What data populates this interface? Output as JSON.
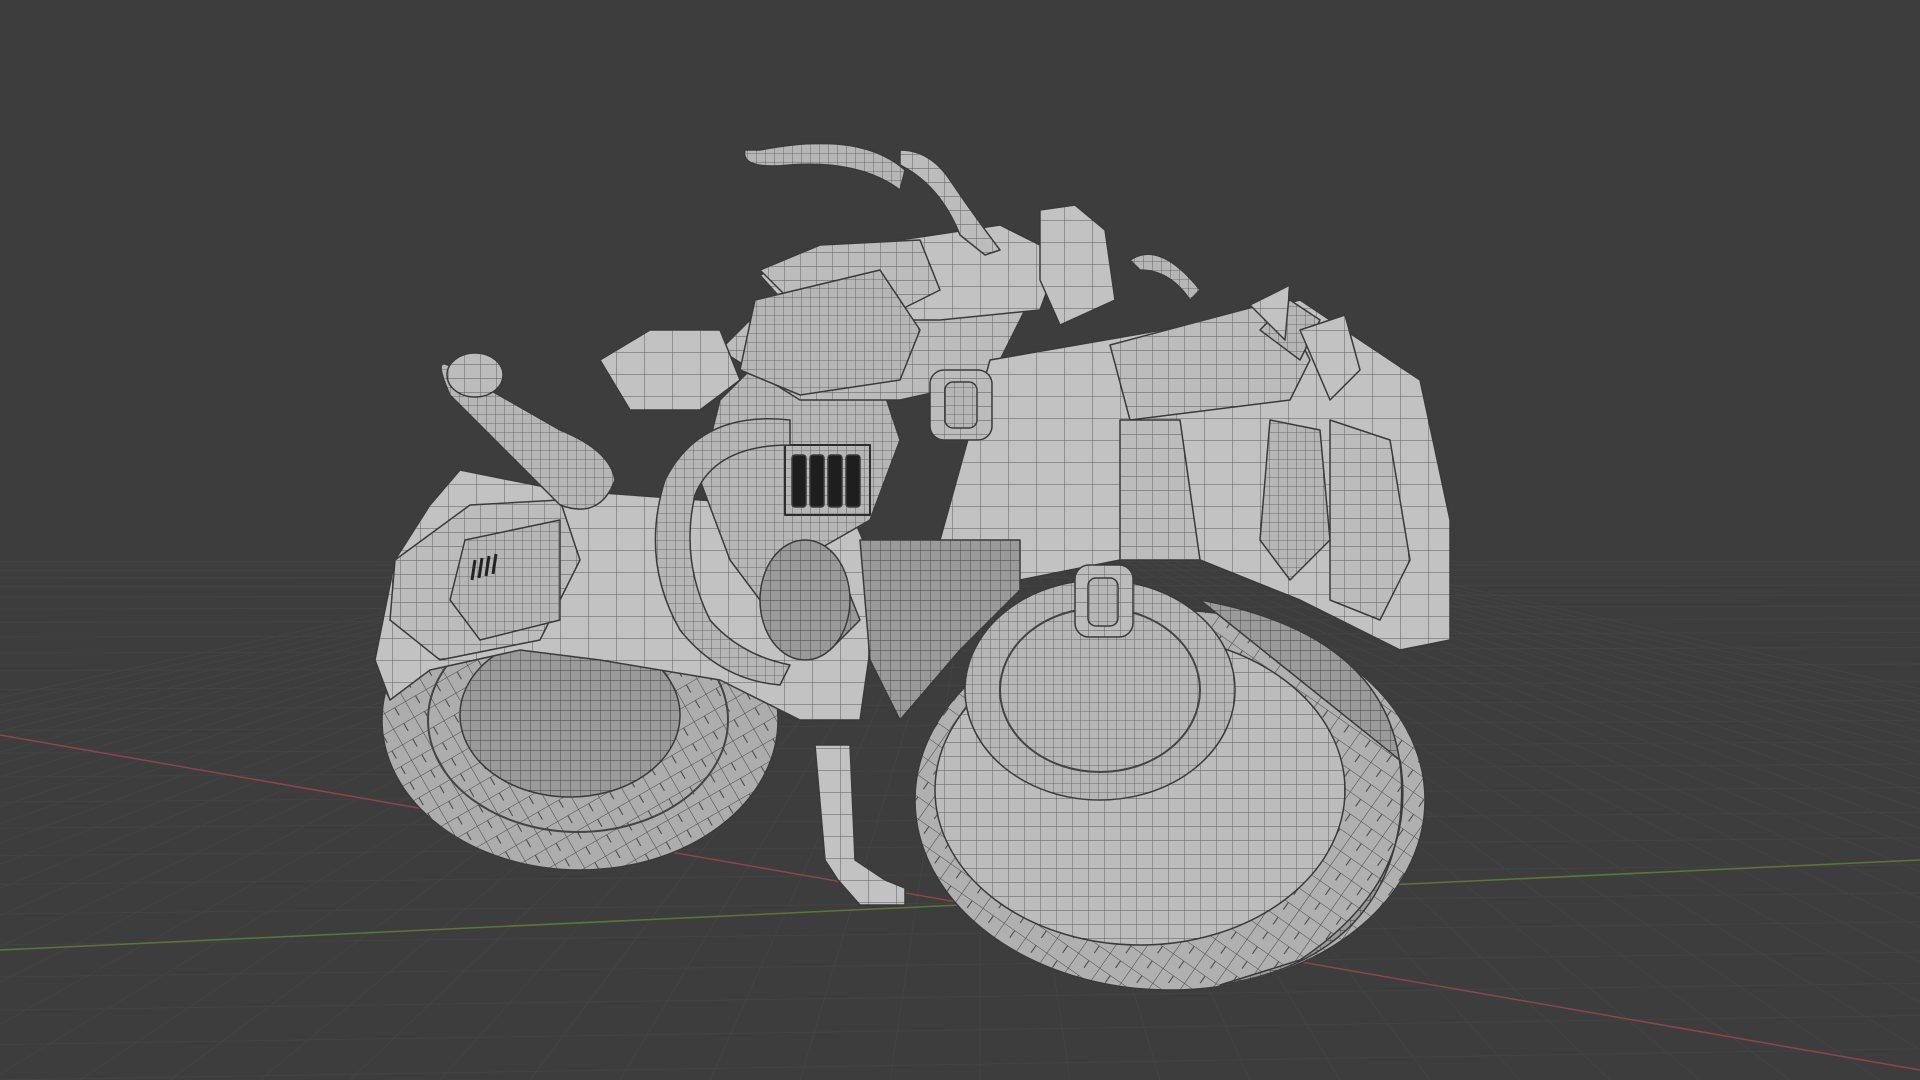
{
  "viewport": {
    "background_color": "#3d3d3d",
    "grid_color": "#4a4a4a",
    "grid_line_color": "#444444",
    "x_axis_color": "#9a4a4a",
    "y_axis_color": "#5d8a3a"
  },
  "model": {
    "subject": "motorcycle",
    "display_mode": "solid-with-wireframe",
    "surface_color": "#b4b4b4",
    "surface_light_color": "#cfcfcf",
    "surface_dark_color": "#8a8a8a",
    "wire_color": "#4a4a4a",
    "parts": [
      {
        "name": "rear-wheel-icon"
      },
      {
        "name": "front-wheel-icon"
      },
      {
        "name": "fuel-tank-icon"
      },
      {
        "name": "handlebar-icon"
      },
      {
        "name": "exhaust-pipe-icon"
      },
      {
        "name": "engine-block-icon"
      },
      {
        "name": "intake-hose-icon"
      },
      {
        "name": "kickstand-icon"
      },
      {
        "name": "rear-fender-icon"
      },
      {
        "name": "front-fender-icon"
      }
    ]
  }
}
